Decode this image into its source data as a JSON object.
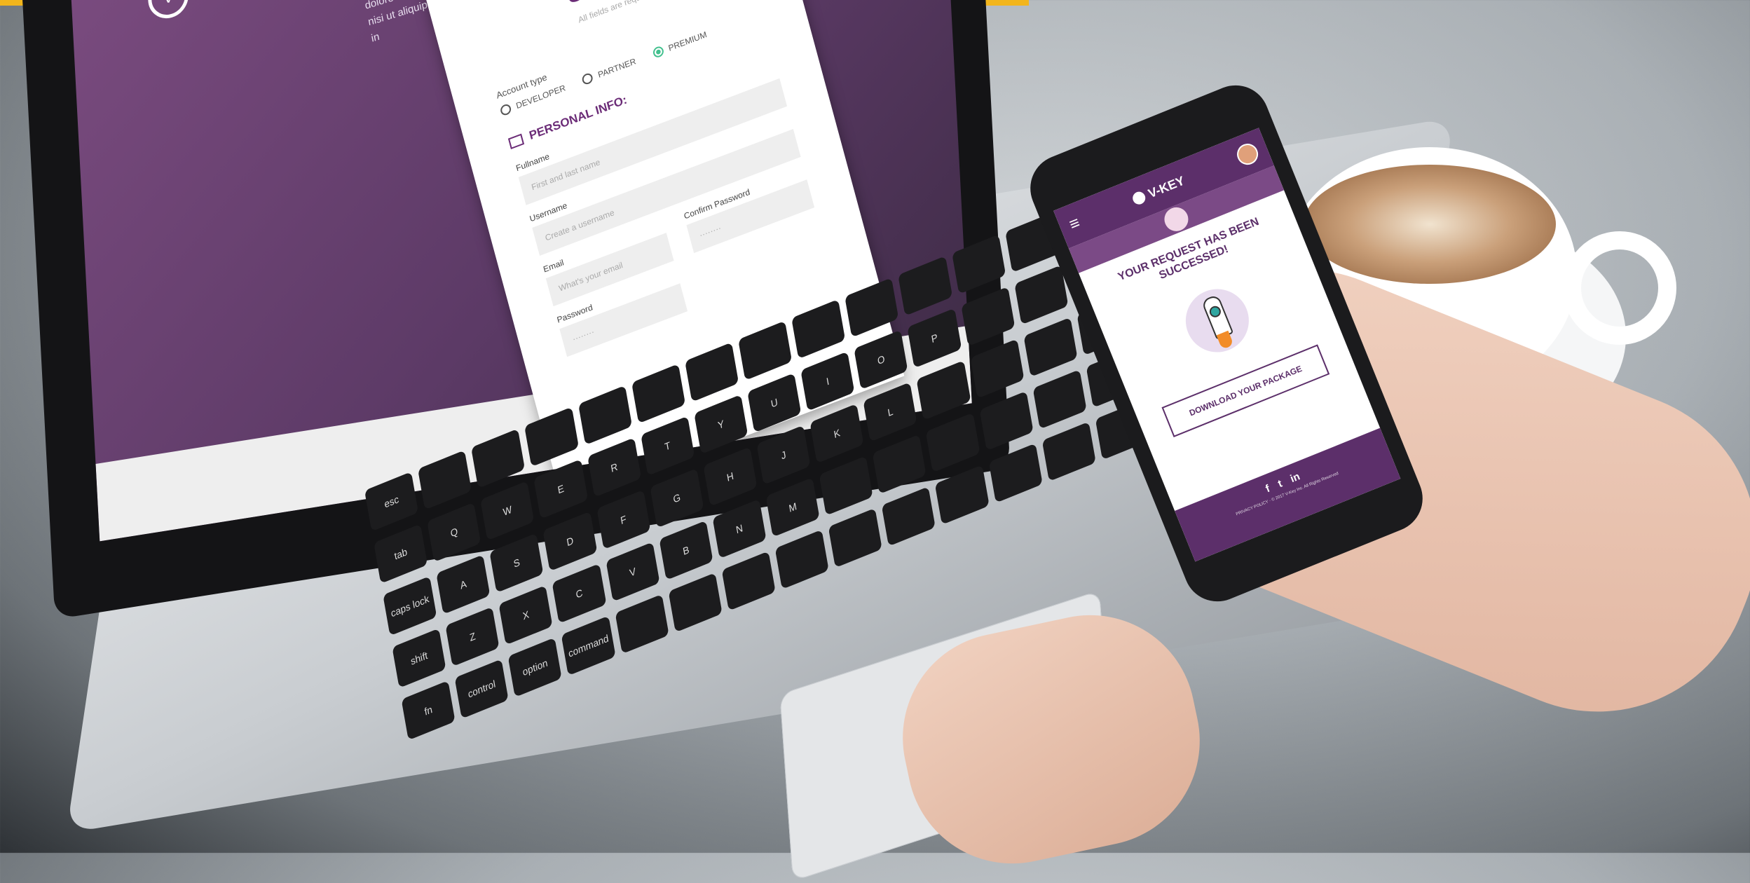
{
  "laptop": {
    "logo_icon": "v-logo-icon",
    "lorem": "Lorem ipsum dolor sit amet, consectetur adipiscing... labore et dolore magna aliqua. Ut enim ad minim veniam, quis... laboris nisi ut aliquip ex ea commodo consequat. Duis aute irure dolor in",
    "modal": {
      "title": "Sign up",
      "subtitle": "All fields are required",
      "close_icon": "close-icon",
      "account_type_label": "Account type",
      "account_types": [
        {
          "label": "DEVELOPER",
          "selected": false
        },
        {
          "label": "PARTNER",
          "selected": false
        },
        {
          "label": "PREMIUM",
          "selected": true
        }
      ],
      "section_title": "PERSONAL INFO:",
      "fields": {
        "fullname_label": "Fullname",
        "fullname_placeholder": "First and last name",
        "username_label": "Username",
        "username_placeholder": "Create a username",
        "email_label": "Email",
        "email_placeholder": "What's your email",
        "confirm_password_label": "Confirm Password",
        "confirm_password_placeholder": "········",
        "password_label": "Password",
        "password_placeholder": "········"
      }
    }
  },
  "keyboard": {
    "keys": [
      "esc",
      "",
      "",
      "",
      "",
      "",
      "",
      "",
      "",
      "",
      "",
      "",
      "",
      "",
      "tab",
      "Q",
      "W",
      "E",
      "R",
      "T",
      "Y",
      "U",
      "I",
      "O",
      "P",
      "",
      "",
      "",
      "caps lock",
      "A",
      "S",
      "D",
      "F",
      "G",
      "H",
      "J",
      "K",
      "L",
      "",
      "",
      "",
      "",
      "shift",
      "Z",
      "X",
      "C",
      "V",
      "B",
      "N",
      "M",
      "",
      "",
      "",
      "",
      "",
      "",
      "fn",
      "control",
      "option",
      "command",
      "",
      "",
      "",
      "",
      "",
      "",
      "",
      "",
      "",
      ""
    ]
  },
  "phone": {
    "brand": "V-KEY",
    "menu_icon": "hamburger-icon",
    "headline": "YOUR REQUEST HAS BEEN SUCCESSED!",
    "download_button": "DOWNLOAD YOUR PACKAGE",
    "social": [
      "f",
      "t",
      "in"
    ],
    "footer_small": "PRIVACY POLICY · © 2017 V-Key Inc. All Rights Reserved"
  },
  "colors": {
    "accent_yellow": "#f2b51c",
    "brand_purple": "#5c2f6a",
    "success_green": "#42c08e"
  }
}
